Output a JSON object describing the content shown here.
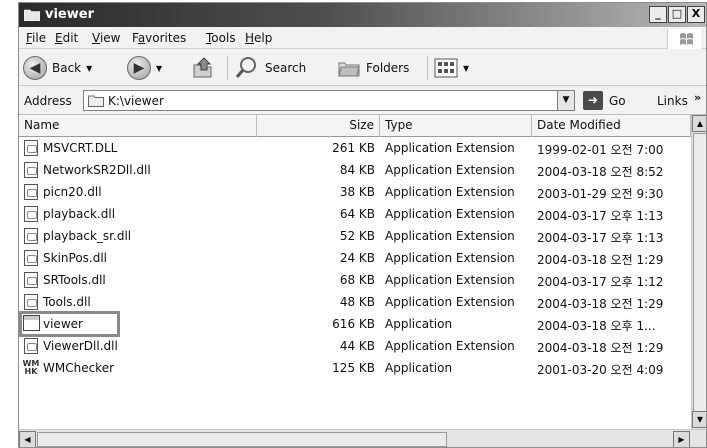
{
  "window": {
    "title": "viewer",
    "buttons": {
      "minimize": "_",
      "maximize": "□",
      "close": "X"
    }
  },
  "menu": [
    {
      "u": "F",
      "rest": "ile"
    },
    {
      "u": "E",
      "rest": "dit"
    },
    {
      "u": "V",
      "rest": "iew"
    },
    {
      "pre": "F",
      "u": "a",
      "rest": "vorites"
    },
    {
      "u": "T",
      "rest": "ools"
    },
    {
      "u": "H",
      "rest": "elp"
    }
  ],
  "toolbar": {
    "back": "Back",
    "search": "Search",
    "folders": "Folders"
  },
  "address": {
    "label": "Address",
    "path": "K:\\viewer",
    "go": "Go",
    "links": "Links"
  },
  "columns": {
    "name": "Name",
    "size": "Size",
    "type": "Type",
    "date": "Date Modified"
  },
  "files": [
    {
      "name": "MSVCRT.DLL",
      "size": "261 KB",
      "type": "Application Extension",
      "date": "1999-02-01 오전 7:00",
      "icon": "dll-file-icon"
    },
    {
      "name": "NetworkSR2Dll.dll",
      "size": "84 KB",
      "type": "Application Extension",
      "date": "2004-03-18 오전 8:52",
      "icon": "dll-file-icon"
    },
    {
      "name": "picn20.dll",
      "size": "38 KB",
      "type": "Application Extension",
      "date": "2003-01-29 오전 9:30",
      "icon": "dll-file-icon"
    },
    {
      "name": "playback.dll",
      "size": "64 KB",
      "type": "Application Extension",
      "date": "2004-03-17 오후 1:13",
      "icon": "dll-file-icon"
    },
    {
      "name": "playback_sr.dll",
      "size": "52 KB",
      "type": "Application Extension",
      "date": "2004-03-17 오후 1:13",
      "icon": "dll-file-icon"
    },
    {
      "name": "SkinPos.dll",
      "size": "24 KB",
      "type": "Application Extension",
      "date": "2004-03-18 오전 1:29",
      "icon": "dll-file-icon"
    },
    {
      "name": "SRTools.dll",
      "size": "68 KB",
      "type": "Application Extension",
      "date": "2004-03-17 오후 1:12",
      "icon": "dll-file-icon"
    },
    {
      "name": "Tools.dll",
      "size": "48 KB",
      "type": "Application Extension",
      "date": "2004-03-18 오전 1:29",
      "icon": "dll-file-icon"
    },
    {
      "name": "viewer",
      "size": "616 KB",
      "type": "Application",
      "date": "2004-03-18 오후 1...",
      "icon": "application-icon"
    },
    {
      "name": "ViewerDll.dll",
      "size": "44 KB",
      "type": "Application Extension",
      "date": "2004-03-18 오전 1:29",
      "icon": "dll-file-icon"
    },
    {
      "name": "WMChecker",
      "size": "125 KB",
      "type": "Application",
      "date": "2001-03-20 오전 4:09",
      "icon": "wm-app-icon",
      "icon_text": "WM\nHK"
    }
  ],
  "highlighted_file": "viewer",
  "colors": {
    "titlebar_dark": "#2a2a2a",
    "highlight_border": "#8a8a8a"
  }
}
